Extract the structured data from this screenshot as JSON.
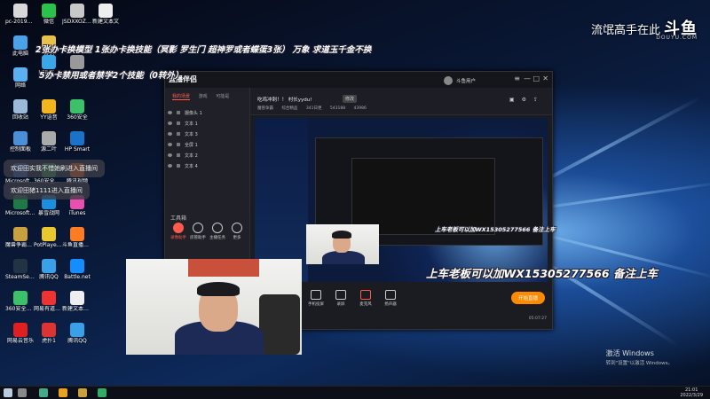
{
  "watermark": {
    "text": "流氓高手在此",
    "logo": "斗鱼",
    "sub": "DOUYU.COM"
  },
  "captions": {
    "line1": "2张办卡换模型 1张办卡换技能（冥影 罗生门 超神罗或者蝶蛋3张） 万象 求道玉千金不换",
    "line2": "5办卡禁用或者禁学2个技能（0转外）",
    "promo": "上车老板可以加WX15305277566 备注上车",
    "promo_small": "上车老板可以加WX15305277566 备注上车"
  },
  "chat": {
    "msg1": "欢迎田实我不惜她刷进入直播间",
    "msg2": "欢迎田猪1111进入直播间"
  },
  "desktop_icons": [
    {
      "label": "pc-20190...",
      "color": "#d8d8d8"
    },
    {
      "label": "微信",
      "color": "#2bc24c"
    },
    {
      "label": "JSDXXOZS...",
      "color": "#c8c8c8"
    },
    {
      "label": "新建文本文",
      "color": "#eeeeee"
    },
    {
      "label": "此电脑",
      "color": "#4aa3e8"
    },
    {
      "label": "其他",
      "color": "#e8c04a"
    },
    {
      "label": "bilibili...",
      "color": "#3aa8e8"
    },
    {
      "label": "CmLemn...",
      "color": "#999999"
    },
    {
      "label": "网络",
      "color": "#5ab0f0"
    },
    {
      "label": "回收站",
      "color": "#9bb9d8"
    },
    {
      "label": "YY语音",
      "color": "#f2b51e"
    },
    {
      "label": "360安全",
      "color": "#3cc06a"
    },
    {
      "label": "控制面板",
      "color": "#4a90d9"
    },
    {
      "label": "源二叶",
      "color": "#aaaaaa"
    },
    {
      "label": "HP Smart",
      "color": "#1a73c8"
    },
    {
      "label": "Microsoft Office Wo...",
      "color": "#2b5fb8"
    },
    {
      "label": "360安全浏览器",
      "color": "#2aa04a"
    },
    {
      "label": "腾讯视频",
      "color": "#ff6a1e"
    },
    {
      "label": "Microsoft Office Exc...",
      "color": "#1e7a44"
    },
    {
      "label": "暴雪战网",
      "color": "#1c8ee0"
    },
    {
      "label": "iTunes",
      "color": "#e850b0"
    },
    {
      "label": "魔兽争霸官方对战平台",
      "color": "#c8a040"
    },
    {
      "label": "PotPlayer 64 bit",
      "color": "#e8c82e"
    },
    {
      "label": "斗鱼直播伴侣7.0",
      "color": "#ff7b22"
    },
    {
      "label": "SteamSetup",
      "color": "#234"
    },
    {
      "label": "腾讯QQ",
      "color": "#3aa0e8"
    },
    {
      "label": "Battle.net",
      "color": "#148eff"
    },
    {
      "label": "360安全卫士",
      "color": "#3cc06a"
    },
    {
      "label": "网易有道词典",
      "color": "#e33"
    },
    {
      "label": "新建文本文档(2)",
      "color": "#eeeeee"
    },
    {
      "label": "网易云音乐",
      "color": "#e02020"
    },
    {
      "label": "虎扑1",
      "color": "#d33"
    },
    {
      "label": "腾讯QQ",
      "color": "#3aa0e8"
    }
  ],
  "app": {
    "brand": "直播伴侣",
    "tabs": [
      "我的场景",
      "游戏",
      "可能是"
    ],
    "sources": [
      "摄像头 1",
      "文本 1",
      "文本 3",
      "全屏 1",
      "文本 2",
      "文本 4"
    ],
    "tools_title": "工具箱",
    "tools": [
      "录像助手",
      "房管助手",
      "主播任务",
      "更多"
    ],
    "room_title": "吃鸡冲刺！！ 村长yydu!",
    "room_badge": "修改",
    "room_meta": [
      "魔兽争霸",
      "综合精品",
      "341日更",
      "543188",
      "43986"
    ],
    "user_name": "斗鱼用户",
    "bottom_buttons": [
      "直播屏幕",
      "摄像头",
      "手机投屏",
      "录屏",
      "麦克风",
      "扬声器"
    ],
    "go_live": "开始直播",
    "timer": "05:07:27"
  },
  "activate": {
    "title": "激活 Windows",
    "sub": "转到\"设置\"以激活 Windows。"
  },
  "clock": {
    "time": "21:01",
    "date": "2022/3/29"
  },
  "colors": {
    "accent": "#ff5a4a",
    "go_live": "#ff8a00"
  }
}
